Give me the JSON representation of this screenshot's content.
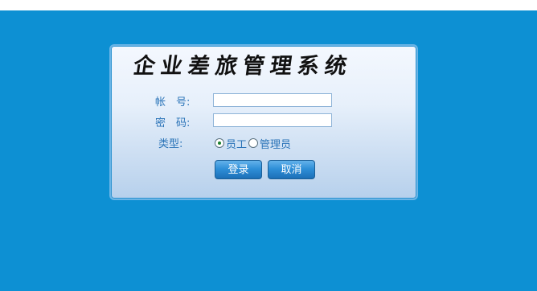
{
  "title": "企业差旅管理系统",
  "labels": {
    "username": "帐　号:",
    "password": "密　码:",
    "type": "类型:"
  },
  "inputs": {
    "username_value": "",
    "password_value": ""
  },
  "user_type": {
    "selected": "员工",
    "options": [
      "员工",
      "管理员"
    ]
  },
  "buttons": {
    "login": "登录",
    "cancel": "取消"
  },
  "colors": {
    "background": "#0d90d3",
    "panel_top": "#f4f8fe",
    "panel_bottom": "#b6d0ec",
    "accent": "#2b74b8"
  }
}
